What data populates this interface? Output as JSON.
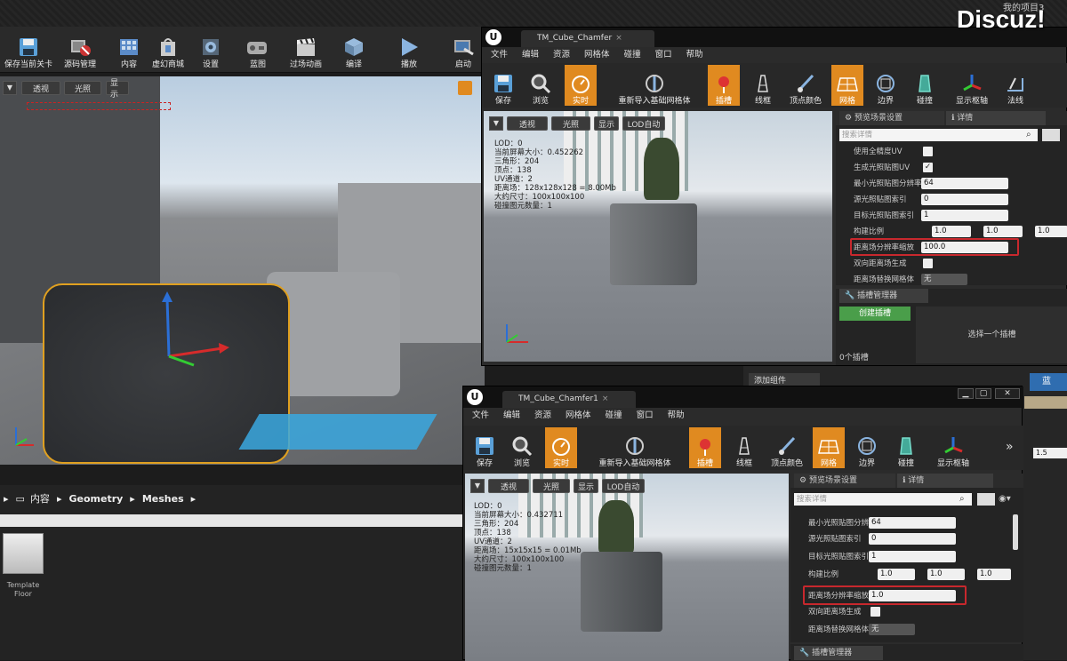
{
  "watermark": {
    "brand": "Discuz!",
    "top_right_label": "我的项目3"
  },
  "main_toolbar": [
    {
      "label": "保存当前关卡",
      "icon": "save-icon"
    },
    {
      "label": "源码管理",
      "icon": "source-control-icon"
    },
    {
      "label": "内容",
      "icon": "content-icon"
    },
    {
      "label": "虚幻商城",
      "icon": "marketplace-icon"
    },
    {
      "label": "设置",
      "icon": "settings-icon"
    },
    {
      "label": "蓝图",
      "icon": "blueprint-icon"
    },
    {
      "label": "过场动画",
      "icon": "cinematics-icon"
    },
    {
      "label": "编译",
      "icon": "build-icon"
    },
    {
      "label": "播放",
      "icon": "play-icon"
    },
    {
      "label": "启动",
      "icon": "launch-icon"
    }
  ],
  "main_viewport": {
    "perspective": "透视",
    "lit": "光照",
    "show": "显示"
  },
  "content_browser": {
    "breadcrumb": [
      "内容",
      "Geometry",
      "Meshes"
    ],
    "asset_name_line1": "Template",
    "asset_name_line2": "Floor"
  },
  "editor_top": {
    "tab_title": "TM_Cube_Chamfer",
    "menu": [
      "文件",
      "编辑",
      "资源",
      "网格体",
      "碰撞",
      "窗口",
      "帮助"
    ],
    "toolbar": [
      {
        "label": "保存",
        "icon": "save-icon"
      },
      {
        "label": "浏览",
        "icon": "browse-icon"
      },
      {
        "label": "实时",
        "icon": "realtime-icon"
      },
      {
        "label": "重新导入基础网格体",
        "icon": "reimport-icon"
      },
      {
        "label": "插槽",
        "icon": "sockets-icon"
      },
      {
        "label": "线框",
        "icon": "wireframe-icon"
      },
      {
        "label": "顶点颜色",
        "icon": "vertex-color-icon"
      },
      {
        "label": "网格",
        "icon": "grid-icon"
      },
      {
        "label": "边界",
        "icon": "bounds-icon"
      },
      {
        "label": "碰撞",
        "icon": "collision-icon"
      },
      {
        "label": "显示枢轴",
        "icon": "pivot-icon"
      },
      {
        "label": "法线",
        "icon": "normals-icon"
      }
    ],
    "viewport": {
      "perspective": "透视",
      "lit": "光照",
      "show": "显示",
      "lod_auto": "LOD自动",
      "stats": [
        "LOD：0",
        "当前屏幕大小：0.452262",
        "三角形：204",
        "顶点：138",
        "UV通道：2",
        "距离场：128x128x128 = 8.00Mb",
        "大约尺寸：100x100x100",
        "碰撞图元数量：1"
      ]
    },
    "tabs": {
      "preview_scene": "预览场景设置",
      "details": "详情"
    },
    "search_placeholder": "搜索详情",
    "props": [
      {
        "label": "使用全精度UV"
      },
      {
        "label": "生成光照贴图UV"
      },
      {
        "label": "最小光照贴图分辨率",
        "value": "64"
      },
      {
        "label": "源光照贴图索引",
        "value": "0"
      },
      {
        "label": "目标光照贴图索引",
        "value": "1"
      },
      {
        "label": "构建比例",
        "x": "1.0",
        "y": "1.0",
        "z": "1.0"
      },
      {
        "label": "距离场分辨率缩放",
        "value": "100.0"
      },
      {
        "label": "双向距离场生成"
      },
      {
        "label": "距离场替换网格体",
        "value": "无"
      }
    ],
    "socket_manager": {
      "title": "插槽管理器",
      "create": "创建插槽",
      "count": "0个插槽",
      "select_hint": "选择一个插槽"
    }
  },
  "editor_bottom": {
    "tab_title": "TM_Cube_Chamfer1",
    "menu": [
      "文件",
      "编辑",
      "资源",
      "网格体",
      "碰撞",
      "窗口",
      "帮助"
    ],
    "toolbar": [
      {
        "label": "保存",
        "icon": "save-icon"
      },
      {
        "label": "浏览",
        "icon": "browse-icon"
      },
      {
        "label": "实时",
        "icon": "realtime-icon"
      },
      {
        "label": "重新导入基础网格体",
        "icon": "reimport-icon"
      },
      {
        "label": "插槽",
        "icon": "sockets-icon"
      },
      {
        "label": "线框",
        "icon": "wireframe-icon"
      },
      {
        "label": "顶点颜色",
        "icon": "vertex-color-icon"
      },
      {
        "label": "网格",
        "icon": "grid-icon"
      },
      {
        "label": "边界",
        "icon": "bounds-icon"
      },
      {
        "label": "碰撞",
        "icon": "collision-icon"
      },
      {
        "label": "显示枢轴",
        "icon": "pivot-icon"
      }
    ],
    "viewport": {
      "perspective": "透视",
      "lit": "光照",
      "show": "显示",
      "lod_auto": "LOD自动",
      "stats": [
        "LOD：0",
        "当前屏幕大小：0.432711",
        "三角形：204",
        "顶点：138",
        "UV通道：2",
        "距离场：15x15x15 = 0.01Mb",
        "大约尺寸：100x100x100",
        "碰撞图元数量：1"
      ]
    },
    "tabs": {
      "preview_scene": "预览场景设置",
      "details": "详情"
    },
    "search_placeholder": "搜索详情",
    "props": [
      {
        "label": "最小光照贴图分辨率",
        "value": "64"
      },
      {
        "label": "源光照贴图索引",
        "value": "0"
      },
      {
        "label": "目标光照贴图索引",
        "value": "1"
      },
      {
        "label": "构建比例",
        "x": "1.0",
        "y": "1.0",
        "z": "1.0"
      },
      {
        "label": "距离场分辨率缩放",
        "value": "1.0"
      },
      {
        "label": "双向距离场生成"
      },
      {
        "label": "距离场替换网格体",
        "value": "无"
      }
    ],
    "socket_manager": {
      "title": "插槽管理器"
    }
  },
  "right_edge": {
    "add_component": "添加组件",
    "blueprint": "蓝",
    "value": "1.5"
  }
}
